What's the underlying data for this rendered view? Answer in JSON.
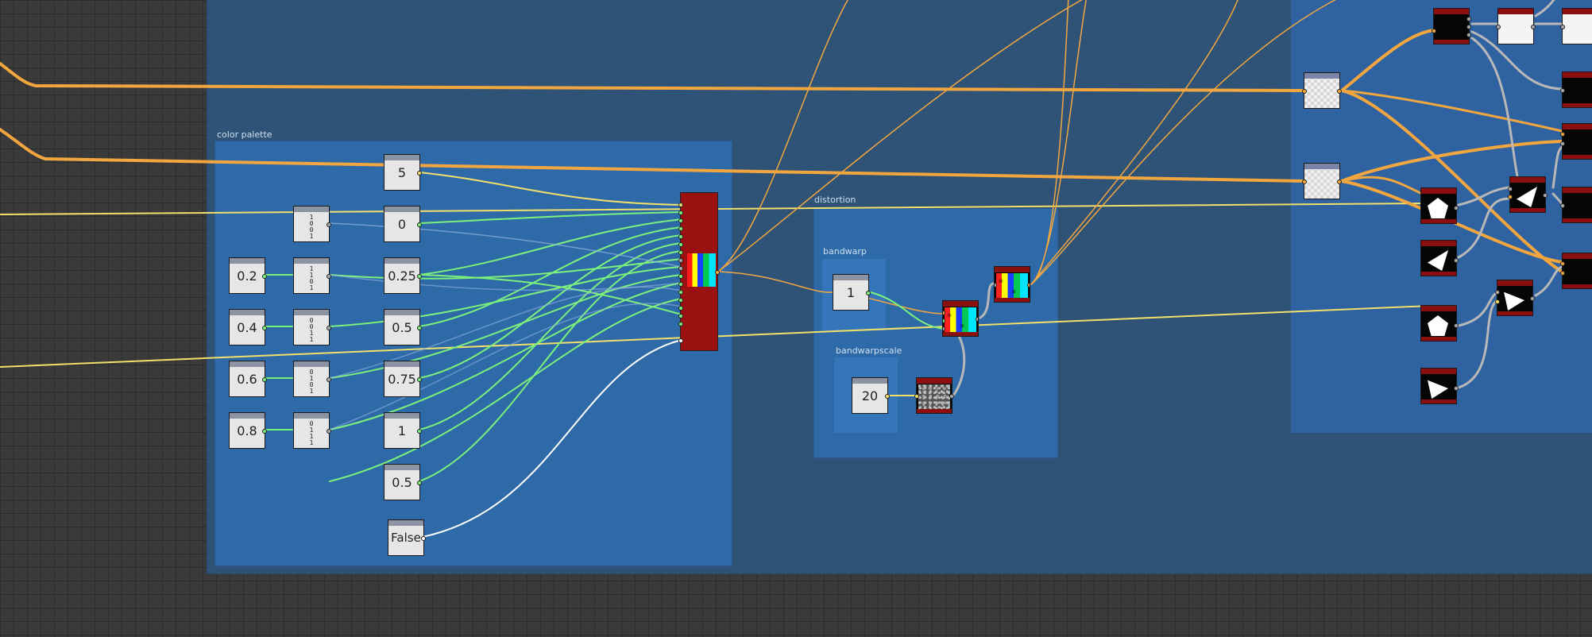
{
  "frames": {
    "color_palette": "color palette",
    "distortion": "distortion",
    "bandwarp": "bandwarp",
    "bandwarpscale": "bandwarpscale"
  },
  "nodes": {
    "num_5": "5",
    "num_0": "0",
    "num_0_25": "0.25",
    "num_0_5": "0.5",
    "num_0_75": "0.75",
    "num_1": "1",
    "num_0_5b": "0.5",
    "bool_false": "False",
    "pos_0_2": "0.2",
    "pos_0_4": "0.4",
    "pos_0_6": "0.6",
    "pos_0_8": "0.8",
    "bandwarp_value": "1",
    "bandwarpscale_value": "20"
  },
  "bit_vectors": [
    [
      "1",
      "0",
      "0",
      "1"
    ],
    [
      "1",
      "1",
      "0",
      "1"
    ],
    [
      "0",
      "0",
      "1",
      "1"
    ],
    [
      "0",
      "1",
      "0",
      "1"
    ],
    [
      "0",
      "1",
      "1",
      "1"
    ]
  ],
  "icons": {
    "gradient": "color-gradient-icon",
    "band": "color-band-icon",
    "noise": "noise-texture-icon",
    "pentagon": "pentagon-shape-icon",
    "triangle": "triangle-shape-icon"
  },
  "colors": {
    "canvas": "#3a3a3a",
    "frame_outer": "#2e5376",
    "frame_palette": "#2f6aa8",
    "wire_orange": "#f2a640",
    "wire_yellow": "#f1e06a",
    "wire_green": "#7cf07c",
    "wire_gray": "#b8b8b8",
    "node_red": "#9b1111"
  }
}
